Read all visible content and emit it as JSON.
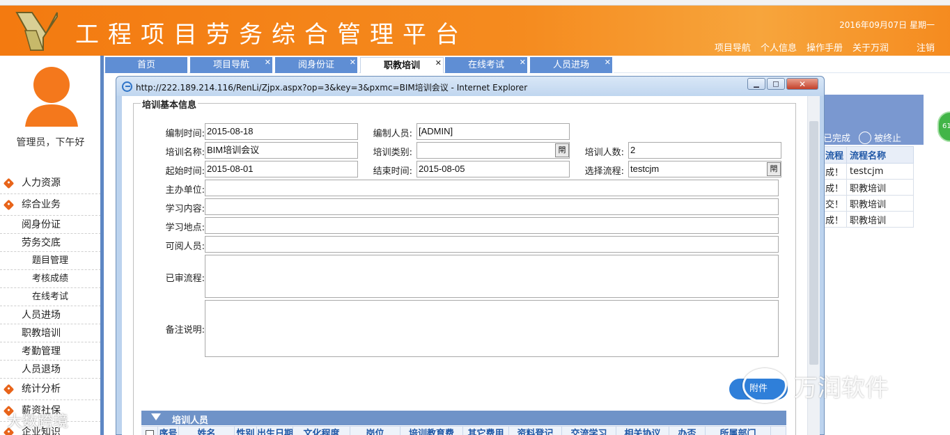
{
  "app": {
    "title": "工程项目劳务综合管理平台",
    "date": "2016年09月07日  星期一"
  },
  "header_links": {
    "nav": "项目导航",
    "profile": "个人信息",
    "manual": "操作手册",
    "about": "关于万润",
    "logout": "注销"
  },
  "user": {
    "greeting": "管理员，下午好"
  },
  "menu": [
    {
      "label": "人力资源",
      "level": 1
    },
    {
      "label": "综合业务",
      "level": 1
    },
    {
      "label": "阅身份证",
      "level": 2
    },
    {
      "label": "劳务交底",
      "level": 2
    },
    {
      "label": "题目管理",
      "level": 3
    },
    {
      "label": "考核成绩",
      "level": 3
    },
    {
      "label": "在线考试",
      "level": 3
    },
    {
      "label": "人员进场",
      "level": 2
    },
    {
      "label": "职教培训",
      "level": 2
    },
    {
      "label": "考勤管理",
      "level": 2
    },
    {
      "label": "人员退场",
      "level": 2
    },
    {
      "label": "统计分析",
      "level": 1
    },
    {
      "label": "薪资社保",
      "level": 1
    },
    {
      "label": "企业知识",
      "level": 1
    }
  ],
  "tabs": [
    {
      "label": "首页",
      "closable": false,
      "active": false
    },
    {
      "label": "项目导航",
      "closable": true,
      "active": false
    },
    {
      "label": "阅身份证",
      "closable": true,
      "active": false
    },
    {
      "label": "职教培训",
      "closable": true,
      "active": true
    },
    {
      "label": "在线考试",
      "closable": true,
      "active": false
    },
    {
      "label": "人员进场",
      "closable": true,
      "active": false
    }
  ],
  "background_panel": {
    "status_done": "已完成",
    "status_terminated": "被终止",
    "columns": [
      "流程",
      "流程名称"
    ],
    "rows": [
      [
        "成！",
        "testcjm"
      ],
      [
        "成！",
        "职教培训"
      ],
      [
        "交！",
        "职教培训"
      ],
      [
        "成！",
        "职教培训"
      ]
    ],
    "badge": "61"
  },
  "ie_window": {
    "title": "http://222.189.214.116/RenLi/Zjpx.aspx?op=3&key=3&pxmc=BIM培训会议 - Internet Explorer",
    "btn_min": "▁",
    "btn_max": "□",
    "btn_close": "✕"
  },
  "form": {
    "legend": "培训基本信息",
    "labels": {
      "compile_time": "编制时间:",
      "compiler": "编制人员:",
      "training_name": "培训名称:",
      "training_type": "培训类别:",
      "training_count": "培训人数:",
      "start_time": "起始时间:",
      "end_time": "结束时间:",
      "select_flow": "选择流程:",
      "host_unit": "主办单位:",
      "content": "学习内容:",
      "location": "学习地点:",
      "viewers": "可阅人员:",
      "reviewed_flow": "已审流程:",
      "remarks": "备注说明:"
    },
    "values": {
      "compile_time": "2015-08-18",
      "compiler": "[ADMIN]",
      "training_name": "BIM培训会议",
      "training_type": "",
      "training_count": "2",
      "start_time": "2015-08-01",
      "end_time": "2015-08-05",
      "select_flow": "testcjm",
      "host_unit": "",
      "content": "",
      "location": "",
      "viewers": "",
      "reviewed_flow": "",
      "remarks": ""
    },
    "picker_glyph": "閈",
    "attach_button": "附件"
  },
  "grid": {
    "title": "培训人员",
    "columns": [
      "序号",
      "姓名",
      "性别",
      "出生日期",
      "文化程度",
      "岗位",
      "培训教育费",
      "其它费用",
      "资料登记",
      "交流学习",
      "相关协议",
      "办否",
      "所属部门"
    ]
  },
  "watermarks": {
    "wechat": "万润软件",
    "corner": "大数跨境"
  },
  "colors": {
    "header_orange": "#f58b1f",
    "tab_blue": "#5f8ed4",
    "grid_header": "#6f93c8",
    "accent_blue": "#2f7fd9"
  }
}
